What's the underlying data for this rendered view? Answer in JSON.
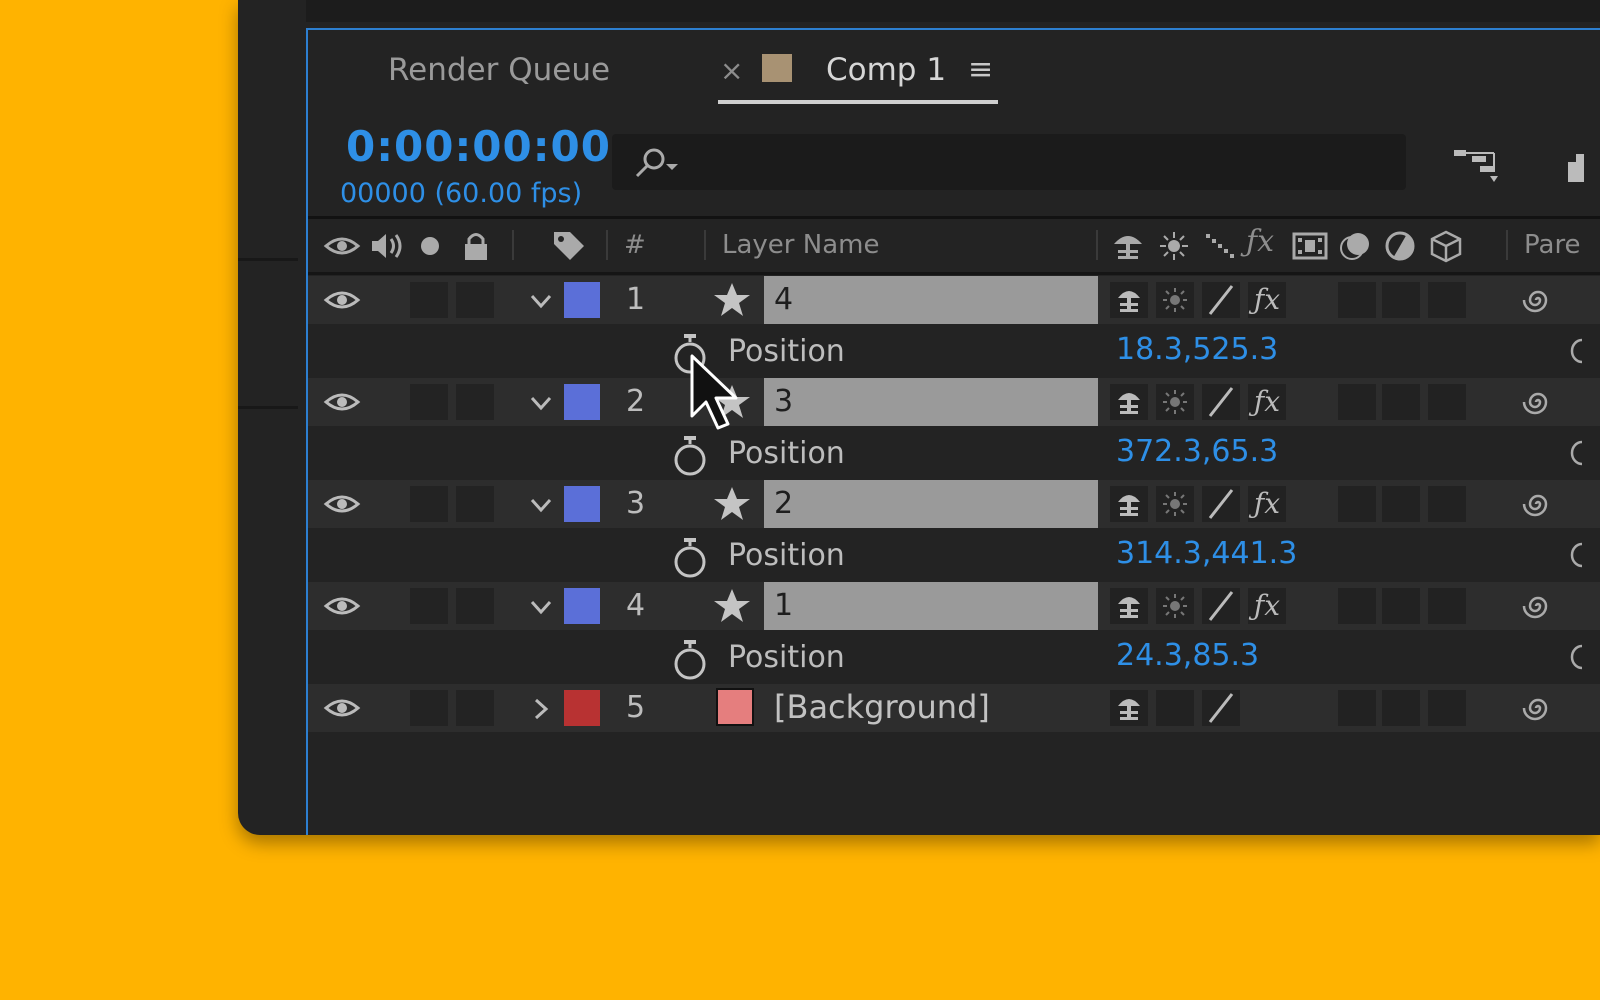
{
  "tabs": {
    "render_queue": "Render Queue",
    "close": "×",
    "comp": "Comp 1",
    "menu": "≡"
  },
  "timeline": {
    "timecode": "0:00:00:00",
    "frames": "00000 (60.00 fps)",
    "search_placeholder": ""
  },
  "columns": {
    "number": "#",
    "layer_name": "Layer Name",
    "parent": "Pare"
  },
  "layers": [
    {
      "index": "1",
      "name": "4",
      "color": "#5B6FD8",
      "expanded": true,
      "property": "Position",
      "value": "18.3,525.3"
    },
    {
      "index": "2",
      "name": "3",
      "color": "#5B6FD8",
      "expanded": true,
      "property": "Position",
      "value": "372.3,65.3"
    },
    {
      "index": "3",
      "name": "2",
      "color": "#5B6FD8",
      "expanded": true,
      "property": "Position",
      "value": "314.3,441.3"
    },
    {
      "index": "4",
      "name": "1",
      "color": "#5B6FD8",
      "expanded": true,
      "property": "Position",
      "value": "24.3,85.3"
    },
    {
      "index": "5",
      "name": "[Background]",
      "color": "#B83232",
      "expanded": false
    }
  ],
  "colors": {
    "background": "#FFB300",
    "accent_blue": "#2E8FE6",
    "panel": "#232323",
    "background_layer_swatch": "#E57E7E",
    "comp_tab_swatch": "#A89273"
  }
}
